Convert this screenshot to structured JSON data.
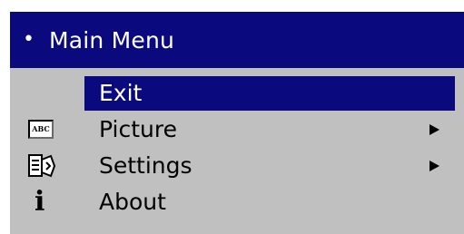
{
  "menu": {
    "bullet": "•",
    "title": "Main Menu",
    "items": [
      {
        "label": "Exit",
        "icon": "",
        "submenu": false,
        "selected": true
      },
      {
        "label": "Picture",
        "icon": "picture-abc-icon",
        "icon_text": "ABC",
        "submenu": true,
        "selected": false
      },
      {
        "label": "Settings",
        "icon": "settings-projector-icon",
        "submenu": true,
        "selected": false
      },
      {
        "label": "About",
        "icon": "info-icon",
        "icon_text": "i",
        "submenu": false,
        "selected": false
      }
    ]
  },
  "colors": {
    "header_bg": "#0a0a7e",
    "menu_bg": "#c0c0c0",
    "highlight_bg": "#0a0a7e",
    "text": "#000000",
    "selected_text": "#ffffff"
  }
}
